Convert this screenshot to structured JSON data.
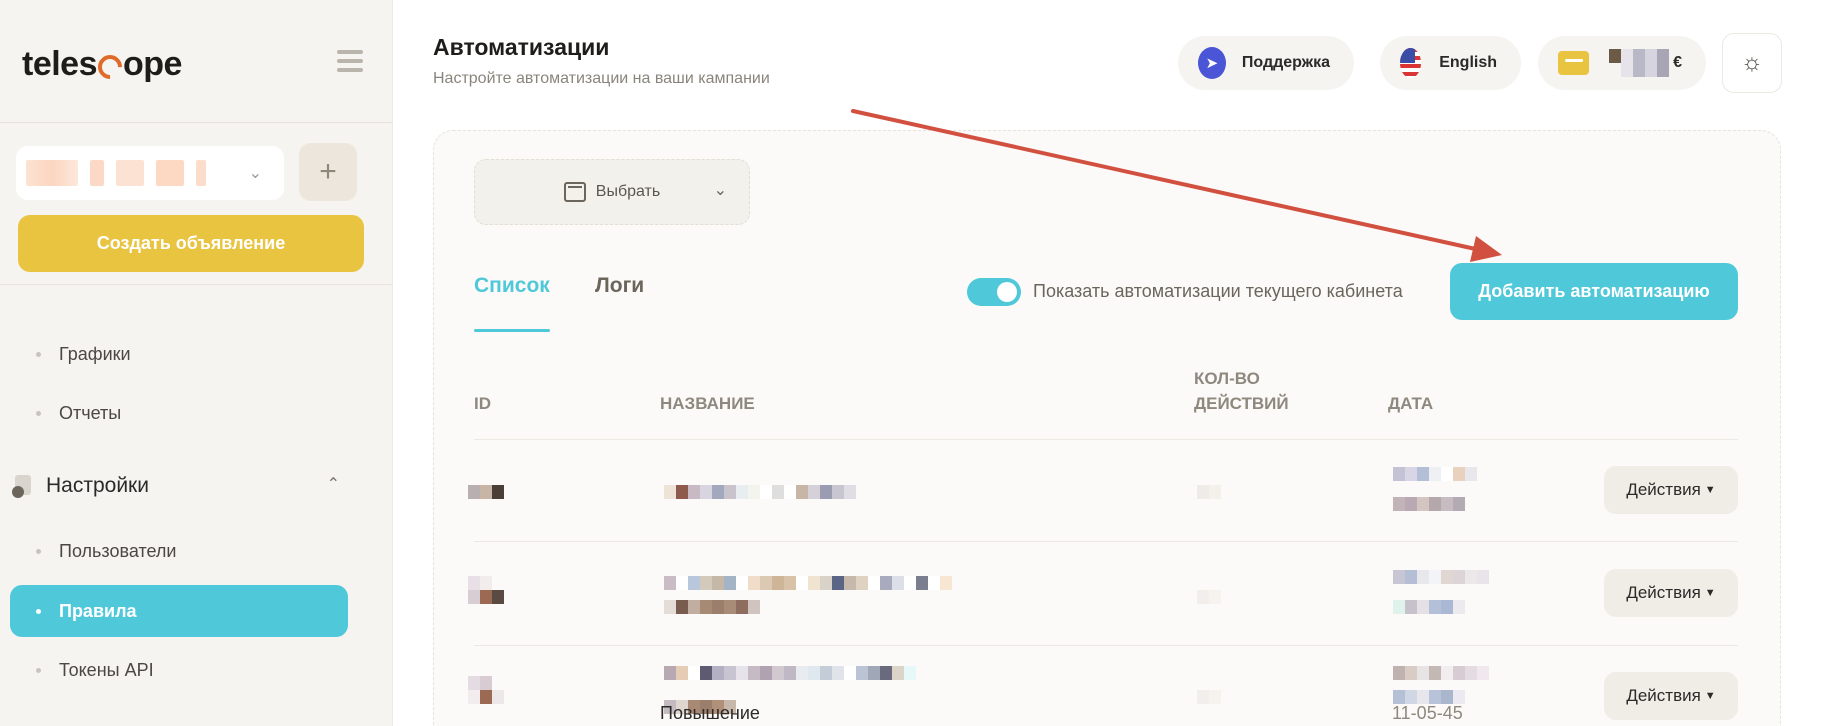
{
  "app": {
    "logo_text_left": "teles",
    "logo_text_right": "ope"
  },
  "sidebar": {
    "create_ad_label": "Создать объявление",
    "add_account_label": "+",
    "items_top": [
      {
        "label": "Графики"
      },
      {
        "label": "Отчеты"
      }
    ],
    "section_settings": {
      "label": "Настройки"
    },
    "items_settings": [
      {
        "label": "Пользователи"
      },
      {
        "label": "Правила",
        "active": true
      },
      {
        "label": "Токены API"
      }
    ]
  },
  "header": {
    "title": "Автоматизации",
    "subtitle": "Настройте автоматизации на ваши кампании",
    "support_label": "Поддержка",
    "language_label": "English",
    "currency_symbol": "€"
  },
  "filters": {
    "date_select_label": "Выбрать"
  },
  "tabs": [
    {
      "label": "Список",
      "active": true
    },
    {
      "label": "Логи"
    }
  ],
  "toggle": {
    "label": "Показать автоматизации текущего кабинета",
    "on": true
  },
  "add_button_label": "Добавить автоматизацию",
  "table": {
    "columns": {
      "id": "ID",
      "name": "НАЗВАНИЕ",
      "count_line1": "КОЛ-ВО",
      "count_line2": "ДЕЙСТВИЙ",
      "date": "ДАТА"
    },
    "action_label": "Действия",
    "partial_name_text": "Повышение",
    "partial_date_text": "11-05-45"
  },
  "colors": {
    "accent": "#4fc8d9",
    "brand_yellow": "#e8c441",
    "arrow": "#d1503f"
  }
}
